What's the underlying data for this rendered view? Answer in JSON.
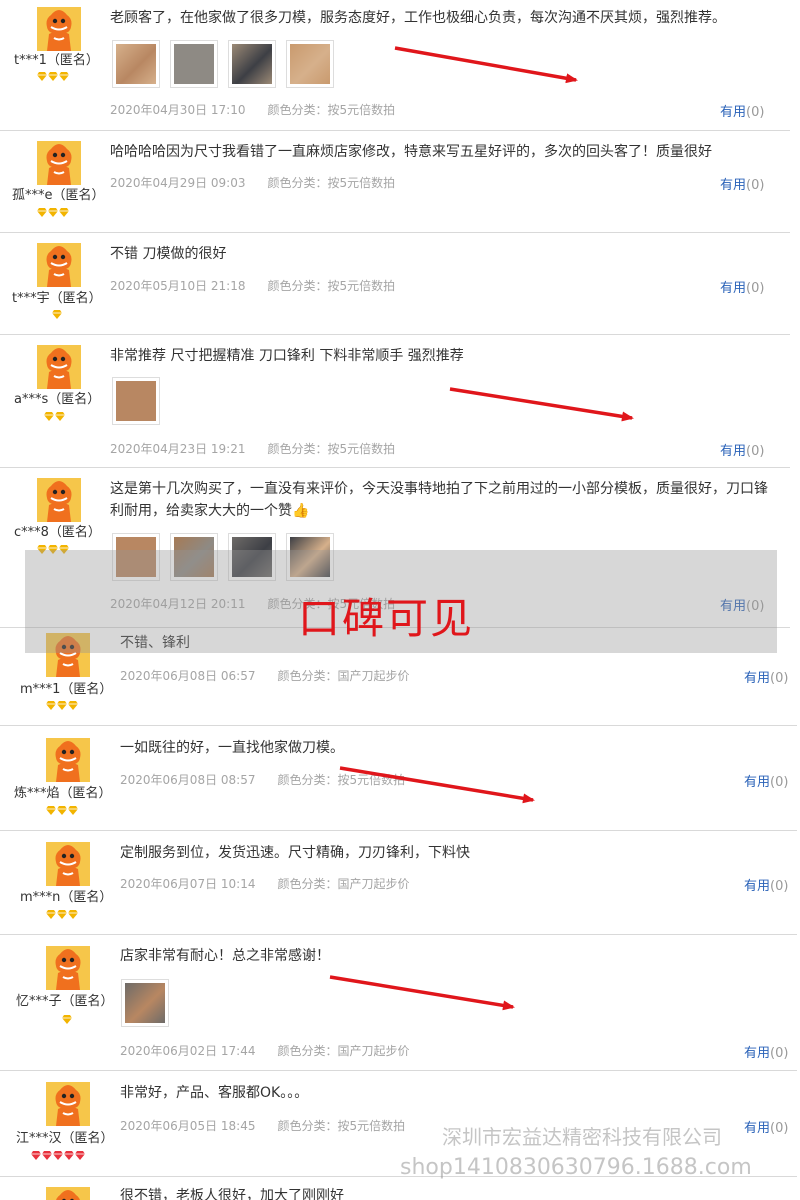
{
  "reviews": [
    {
      "user": "t***1（匿名）",
      "rank_gems": 3,
      "rank_color": "#f2b400",
      "text": "老顾客了，在他家做了很多刀模，服务态度好，工作也极细心负责，每次沟通不厌其烦，强烈推荐。",
      "images": [
        "wood-plate-photo-1",
        "wood-plate-photo-2",
        "wood-plate-photo-3",
        "wood-plate-photo-4"
      ],
      "date": "2020年04月30日 17:10",
      "category": "颜色分类：按5元倍数拍",
      "useful_label": "有用",
      "useful_count": "(0)"
    },
    {
      "user": "孤***e（匿名）",
      "rank_gems": 3,
      "rank_color": "#f2b400",
      "text": "哈哈哈哈因为尺寸我看错了一直麻烦店家修改，特意来写五星好评的，多次的回头客了！质量很好",
      "images": [],
      "date": "2020年04月29日 09:03",
      "category": "颜色分类：按5元倍数拍",
      "useful_label": "有用",
      "useful_count": "(0)"
    },
    {
      "user": "t***宇（匿名）",
      "rank_gems": 1,
      "rank_color": "#f2b400",
      "text": "不错 刀模做的很好",
      "images": [],
      "date": "2020年05月10日 21:18",
      "category": "颜色分类：按5元倍数拍",
      "useful_label": "有用",
      "useful_count": "(0)"
    },
    {
      "user": "a***s（匿名）",
      "rank_gems": 2,
      "rank_color": "#f2b400",
      "text": "非常推荐 尺寸把握精准 刀口锋利 下料非常顺手 强烈推荐",
      "images": [
        "cut-leather-photo"
      ],
      "date": "2020年04月23日 19:21",
      "category": "颜色分类：按5元倍数拍",
      "useful_label": "有用",
      "useful_count": "(0)"
    },
    {
      "user": "c***8（匿名）",
      "rank_gems": 3,
      "rank_color": "#f2b400",
      "text": "这是第十几次购买了，一直没有来评价，今天没事特地拍了下之前用过的一小部分模板，质量很好，刀口锋利耐用，给卖家大大的一个赞👍",
      "images": [
        "die-board-photo-1",
        "die-board-photo-2",
        "die-board-photo-3",
        "die-board-photo-4"
      ],
      "date": "2020年04月12日 20:11",
      "category": "颜色分类：按5元倍数拍",
      "useful_label": "有用",
      "useful_count": "(0)"
    },
    {
      "user": "m***1（匿名）",
      "rank_gems": 3,
      "rank_color": "#f2b400",
      "text": "不错、锋利",
      "images": [],
      "date": "2020年06月08日 06:57",
      "category": "颜色分类：国产刀起步价",
      "useful_label": "有用",
      "useful_count": "(0)"
    },
    {
      "user": "炼***焰（匿名）",
      "rank_gems": 3,
      "rank_color": "#f2b400",
      "text": "一如既往的好，一直找他家做刀模。",
      "images": [],
      "date": "2020年06月08日 08:57",
      "category": "颜色分类：按5元倍数拍",
      "useful_label": "有用",
      "useful_count": "(0)"
    },
    {
      "user": "m***n（匿名）",
      "rank_gems": 3,
      "rank_color": "#f2b400",
      "text": "定制服务到位，发货迅速。尺寸精确，刀刃锋利，下料快",
      "images": [],
      "date": "2020年06月07日 10:14",
      "category": "颜色分类：国产刀起步价",
      "useful_label": "有用",
      "useful_count": "(0)"
    },
    {
      "user": "忆***子（匿名）",
      "rank_gems": 1,
      "rank_color": "#f2b400",
      "text": "店家非常有耐心！总之非常感谢！",
      "images": [
        "leather-product-photo"
      ],
      "date": "2020年06月02日 17:44",
      "category": "颜色分类：国产刀起步价",
      "useful_label": "有用",
      "useful_count": "(0)"
    },
    {
      "user": "江***汉（匿名）",
      "rank_gems": 5,
      "rank_color": "#e8323e",
      "text": "非常好，产品、客服都OK。。。",
      "images": [],
      "date": "2020年06月05日 18:45",
      "category": "颜色分类：按5元倍数拍",
      "useful_label": "有用",
      "useful_count": "(0)"
    },
    {
      "user": "",
      "rank_gems": 0,
      "rank_color": "#f2b400",
      "text": "很不错，老板人很好，加大了刚刚好",
      "images": [],
      "date": "",
      "category": "",
      "useful_label": "",
      "useful_count": ""
    }
  ],
  "overlay_caption": "口碑可见",
  "watermark": {
    "company": "深圳市宏益达精密科技有限公司",
    "shop_url": "shop1410830630796.1688.com"
  },
  "colors": {
    "arrow": "#e0161b",
    "link": "#2a62b8",
    "meta": "#a5a5a5",
    "avatar_bg": "#f6c64a",
    "mascot": "#f0701e"
  }
}
